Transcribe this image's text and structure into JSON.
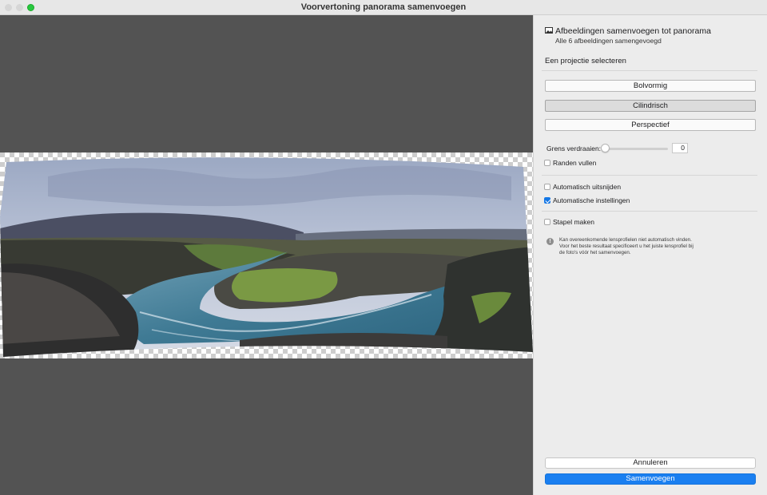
{
  "window": {
    "title": "Voorvertoning panorama samenvoegen"
  },
  "panel": {
    "header_icon": "image-icon",
    "header_title": "Afbeeldingen samenvoegen tot panorama",
    "header_subtitle": "Alle 6 afbeeldingen samengevoegd",
    "projection_label": "Een projectie selecteren",
    "projections": [
      {
        "label": "Bolvormig",
        "selected": false
      },
      {
        "label": "Cilindrisch",
        "selected": true
      },
      {
        "label": "Perspectief",
        "selected": false
      }
    ],
    "boundary_warp": {
      "label": "Grens verdraaien:",
      "value": "0"
    },
    "fill_edges": {
      "label": "Randen vullen",
      "checked": false
    },
    "auto_crop": {
      "label": "Automatisch uitsnijden",
      "checked": false
    },
    "auto_settings": {
      "label": "Automatische instellingen",
      "checked": true
    },
    "create_stack": {
      "label": "Stapel maken",
      "checked": false
    },
    "warning": {
      "icon": "exclamation-icon",
      "text": "Kan overeenkomende lensprofielen niet automatisch vinden. Voor het beste resultaat specificeert u het juiste lensprofiel bij de foto's vóór het samenvoegen."
    },
    "cancel_label": "Annuleren",
    "merge_label": "Samenvoegen"
  },
  "colors": {
    "accent": "#1a7ff0",
    "preview_bg": "#535353",
    "panel_bg": "#ececec",
    "zoom_button": "#28c840"
  }
}
